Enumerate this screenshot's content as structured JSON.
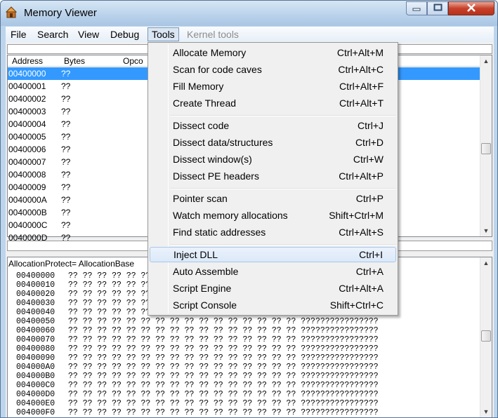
{
  "window": {
    "title": "Memory Viewer",
    "icon": "cheat-engine-icon"
  },
  "menubar": {
    "file": "File",
    "search": "Search",
    "view": "View",
    "debug": "Debug",
    "tools": "Tools",
    "kernel_tools": "Kernel tools"
  },
  "disassembler": {
    "columns": {
      "address": "Address",
      "bytes": "Bytes",
      "opcode": "Opco"
    },
    "rows": [
      {
        "address": "00400000",
        "bytes": "??"
      },
      {
        "address": "00400001",
        "bytes": "??"
      },
      {
        "address": "00400002",
        "bytes": "??"
      },
      {
        "address": "00400003",
        "bytes": "??"
      },
      {
        "address": "00400004",
        "bytes": "??"
      },
      {
        "address": "00400005",
        "bytes": "??"
      },
      {
        "address": "00400006",
        "bytes": "??"
      },
      {
        "address": "00400007",
        "bytes": "??"
      },
      {
        "address": "00400008",
        "bytes": "??"
      },
      {
        "address": "00400009",
        "bytes": "??"
      },
      {
        "address": "0040000A",
        "bytes": "??"
      },
      {
        "address": "0040000B",
        "bytes": "??"
      },
      {
        "address": "0040000C",
        "bytes": "??"
      },
      {
        "address": "0040000D",
        "bytes": "??"
      }
    ],
    "selected_index": 0
  },
  "hexview": {
    "info": "AllocationProtect= AllocationBase",
    "hidden_row_content": "?? ?? ?? ?? ?? ??",
    "row_content": "?? ?? ?? ?? ?? ?? ?? ?? ?? ?? ?? ?? ?? ?? ?? ?? ????????????????",
    "rows": [
      {
        "address": "00400000",
        "full": false
      },
      {
        "address": "00400010",
        "full": false
      },
      {
        "address": "00400020",
        "full": false
      },
      {
        "address": "00400030",
        "full": false
      },
      {
        "address": "00400040",
        "full": false
      },
      {
        "address": "00400050",
        "full": true
      },
      {
        "address": "00400060",
        "full": true
      },
      {
        "address": "00400070",
        "full": true
      },
      {
        "address": "00400080",
        "full": true
      },
      {
        "address": "00400090",
        "full": true
      },
      {
        "address": "004000A0",
        "full": true
      },
      {
        "address": "004000B0",
        "full": true
      },
      {
        "address": "004000C0",
        "full": true
      },
      {
        "address": "004000D0",
        "full": true
      },
      {
        "address": "004000E0",
        "full": true
      },
      {
        "address": "004000F0",
        "full": true
      }
    ]
  },
  "tools_menu": {
    "groups": [
      [
        {
          "label": "Allocate Memory",
          "shortcut": "Ctrl+Alt+M"
        },
        {
          "label": "Scan for code caves",
          "shortcut": "Ctrl+Alt+C"
        },
        {
          "label": "Fill Memory",
          "shortcut": "Ctrl+Alt+F"
        },
        {
          "label": "Create Thread",
          "shortcut": "Ctrl+Alt+T"
        }
      ],
      [
        {
          "label": "Dissect code",
          "shortcut": "Ctrl+J"
        },
        {
          "label": "Dissect data/structures",
          "shortcut": "Ctrl+D"
        },
        {
          "label": "Dissect window(s)",
          "shortcut": "Ctrl+W"
        },
        {
          "label": "Dissect PE headers",
          "shortcut": "Ctrl+Alt+P"
        }
      ],
      [
        {
          "label": "Pointer scan",
          "shortcut": "Ctrl+P"
        },
        {
          "label": "Watch memory allocations",
          "shortcut": "Shift+Ctrl+M"
        },
        {
          "label": "Find static addresses",
          "shortcut": "Ctrl+Alt+S"
        }
      ],
      [
        {
          "label": "Inject DLL",
          "shortcut": "Ctrl+I",
          "highlighted": true
        },
        {
          "label": "Auto Assemble",
          "shortcut": "Ctrl+A"
        },
        {
          "label": "Script Engine",
          "shortcut": "Ctrl+Alt+A"
        },
        {
          "label": "Script Console",
          "shortcut": "Shift+Ctrl+C"
        }
      ]
    ]
  }
}
